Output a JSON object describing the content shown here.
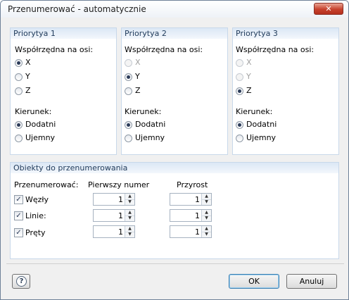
{
  "window": {
    "title": "Przenumerować - automatycznie",
    "close_label": "✕"
  },
  "priorities": [
    {
      "header": "Priorytya 1",
      "coord_label": "Współrzędna na osi:",
      "axes": [
        {
          "label": "X",
          "selected": true,
          "disabled": false
        },
        {
          "label": "Y",
          "selected": false,
          "disabled": false
        },
        {
          "label": "Z",
          "selected": false,
          "disabled": false
        }
      ],
      "direction_label": "Kierunek:",
      "directions": [
        {
          "label": "Dodatni",
          "selected": true
        },
        {
          "label": "Ujemny",
          "selected": false
        }
      ]
    },
    {
      "header": "Priorytya 2",
      "coord_label": "Współrzędna na osi:",
      "axes": [
        {
          "label": "X",
          "selected": false,
          "disabled": true
        },
        {
          "label": "Y",
          "selected": true,
          "disabled": false
        },
        {
          "label": "Z",
          "selected": false,
          "disabled": false
        }
      ],
      "direction_label": "Kierunek:",
      "directions": [
        {
          "label": "Dodatni",
          "selected": true
        },
        {
          "label": "Ujemny",
          "selected": false
        }
      ]
    },
    {
      "header": "Priorytya 3",
      "coord_label": "Współrzędna na osi:",
      "axes": [
        {
          "label": "X",
          "selected": false,
          "disabled": true
        },
        {
          "label": "Y",
          "selected": false,
          "disabled": true
        },
        {
          "label": "Z",
          "selected": true,
          "disabled": false
        }
      ],
      "direction_label": "Kierunek:",
      "directions": [
        {
          "label": "Dodatni",
          "selected": true
        },
        {
          "label": "Ujemny",
          "selected": false
        }
      ]
    }
  ],
  "objects": {
    "header": "Obiekty do przenumerowania",
    "col_renumber": "Przenumerować:",
    "col_first": "Pierwszy numer",
    "col_increment": "Przyrost",
    "rows": [
      {
        "label": "Węzły",
        "checked": true,
        "first": "1",
        "increment": "1"
      },
      {
        "label": "Linie:",
        "checked": true,
        "first": "1",
        "increment": "1"
      },
      {
        "label": "Pręty",
        "checked": true,
        "first": "1",
        "increment": "1"
      }
    ]
  },
  "buttons": {
    "ok": "OK",
    "cancel": "Anuluj",
    "help_icon": "?"
  },
  "colors": {
    "group_header": "#dbe7f5",
    "group_border": "#c8d8ea",
    "close_red": "#c7412d"
  }
}
